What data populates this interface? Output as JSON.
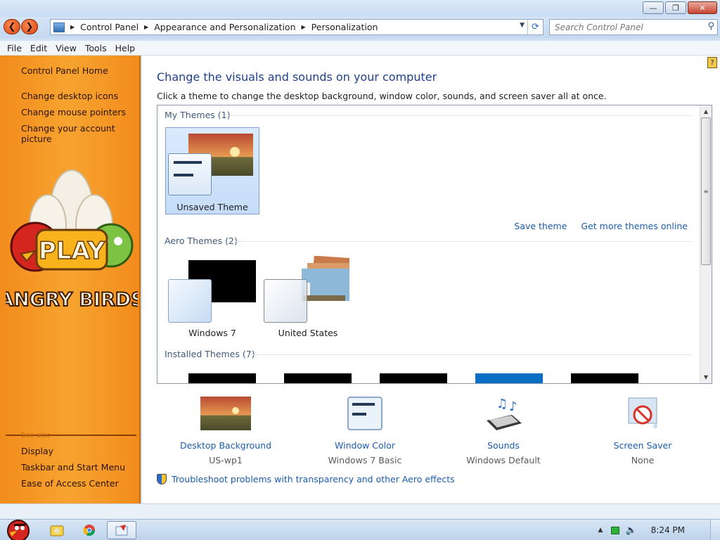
{
  "titlebar": {
    "buttons": [
      "minimize",
      "maximize",
      "close"
    ]
  },
  "address": {
    "breadcrumbs": [
      "Control Panel",
      "Appearance and Personalization",
      "Personalization"
    ],
    "search_placeholder": "Search Control Panel"
  },
  "menu": [
    "File",
    "Edit",
    "View",
    "Tools",
    "Help"
  ],
  "sidebar": {
    "home": "Control Panel Home",
    "links": [
      "Change desktop icons",
      "Change mouse pointers",
      "Change your account picture"
    ],
    "see_also_title": "See also",
    "see_also": [
      "Display",
      "Taskbar and Start Menu",
      "Ease of Access Center"
    ],
    "art_text": {
      "top": "PLAY",
      "bottom": "ANGRY BIRDS"
    },
    "accent_color": "#f28c1c"
  },
  "content": {
    "heading": "Change the visuals and sounds on your computer",
    "subheading": "Click a theme to change the desktop background, window color, sounds, and screen saver all at once.",
    "groups": [
      {
        "label": "My Themes (1)",
        "themes": [
          {
            "name": "Unsaved Theme",
            "selected": true
          }
        ]
      },
      {
        "label": "Aero Themes (2)",
        "themes": [
          {
            "name": "Windows 7"
          },
          {
            "name": "United States"
          }
        ]
      },
      {
        "label": "Installed Themes (7)",
        "themes": []
      }
    ],
    "save_theme": "Save theme",
    "get_more": "Get more themes online",
    "settings": [
      {
        "label": "Desktop Background",
        "value": "US-wp1",
        "icon": "desktop-background-icon"
      },
      {
        "label": "Window Color",
        "value": "Windows 7 Basic",
        "icon": "window-color-icon"
      },
      {
        "label": "Sounds",
        "value": "Windows Default",
        "icon": "sounds-icon"
      },
      {
        "label": "Screen Saver",
        "value": "None",
        "icon": "screen-saver-icon"
      }
    ],
    "troubleshoot": "Troubleshoot problems with transparency and other Aero effects"
  },
  "taskbar": {
    "clock": "8:24 PM"
  }
}
